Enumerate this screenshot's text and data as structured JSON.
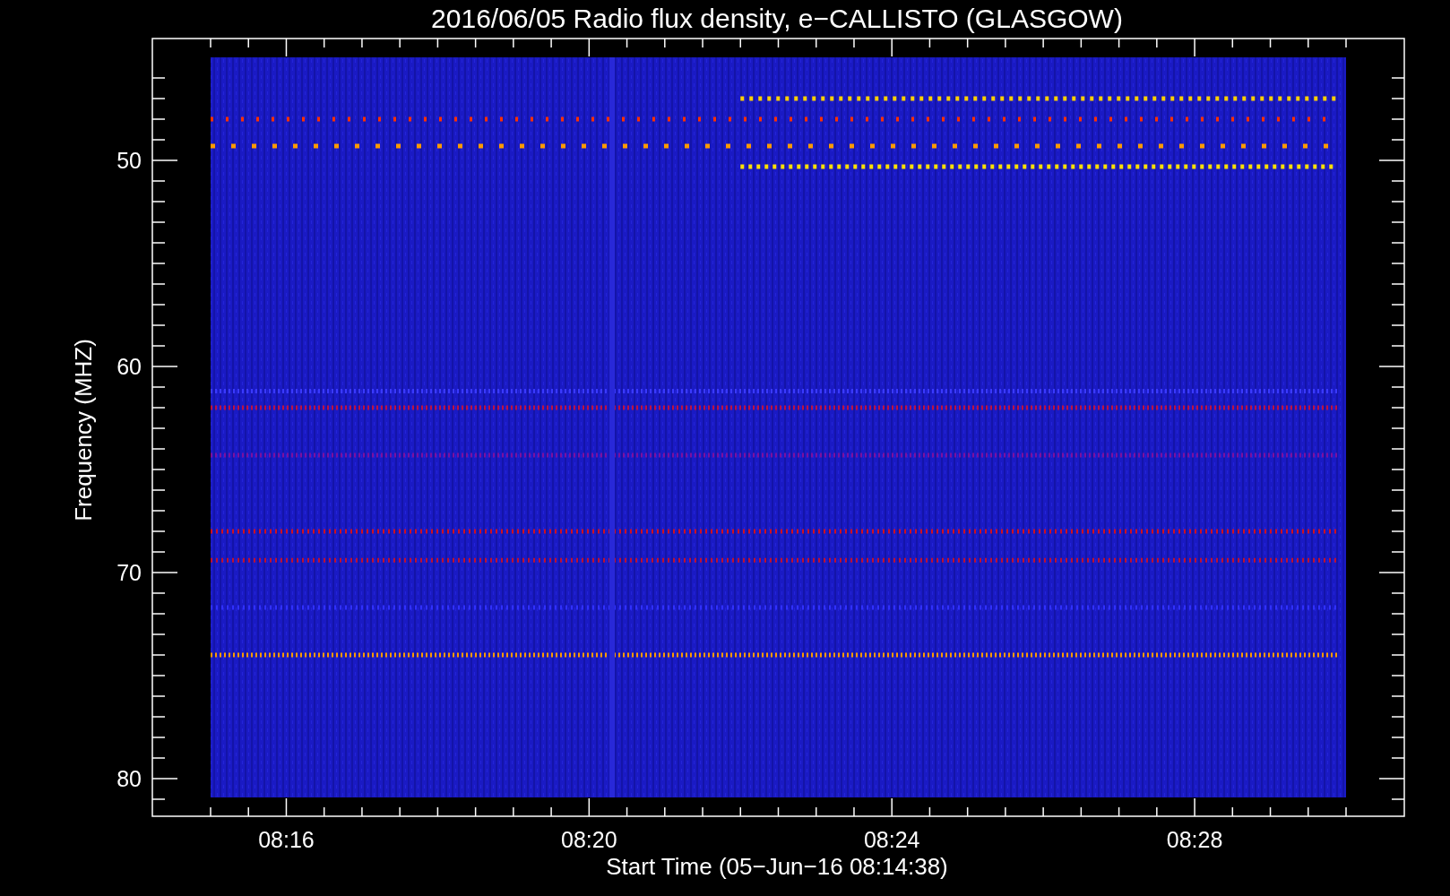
{
  "plot": {
    "title": "2016/06/05  Radio flux density, e−CALLISTO (GLASGOW)",
    "xlabel": "Start Time (05−Jun−16 08:14:38)",
    "ylabel": "Frequency (MHZ)",
    "xticks": [
      "08:16",
      "08:20",
      "08:24",
      "08:28"
    ],
    "yticks": [
      "50",
      "60",
      "70",
      "80"
    ]
  }
}
